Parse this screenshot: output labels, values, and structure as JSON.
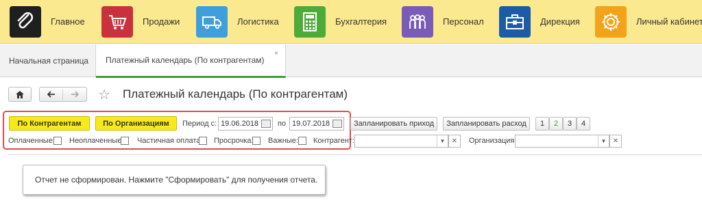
{
  "sections": [
    {
      "label": "Главное",
      "icon": "paperclip-icon",
      "color": "#1f1f1f"
    },
    {
      "label": "Продажи",
      "icon": "cart-icon",
      "color": "#c9323d"
    },
    {
      "label": "Логистика",
      "icon": "truck-icon",
      "color": "#3f9fdc"
    },
    {
      "label": "Бухгалтерия",
      "icon": "calculator-icon",
      "color": "#4eab3a"
    },
    {
      "label": "Персонал",
      "icon": "people-icon",
      "color": "#7a5bb6"
    },
    {
      "label": "Дирекция",
      "icon": "briefcase-icon",
      "color": "#1c5ba6"
    },
    {
      "label": "Личный кабинет",
      "icon": "gear-icon",
      "color": "#f2a31a"
    }
  ],
  "tabs": {
    "home": "Начальная страница",
    "active": "Платежный календарь (По контрагентам)",
    "close": "×"
  },
  "page": {
    "title": "Платежный календарь (По контрагентам)"
  },
  "filters": {
    "by_counterparty": "По Контрагентам",
    "by_organization": "По Организациям",
    "period_from_label": "Период с:",
    "period_from": "19.06.2018",
    "period_to_label": "по",
    "period_to": "19.07.2018",
    "plan_income": "Запланировать приход",
    "plan_expense": "Запланировать расход",
    "pages": [
      "1",
      "2",
      "3",
      "4"
    ],
    "active_page_color": "#3f9c35",
    "paid": "Оплаченные:",
    "unpaid": "Неоплаченные:",
    "partial": "Частичная оплата:",
    "overdue": "Просрочка:",
    "important": "Важные:",
    "counterparty": "Контрагент:",
    "organization": "Организация:"
  },
  "message": "Отчет не сформирован. Нажмите \"Сформировать\" для получения отчета."
}
